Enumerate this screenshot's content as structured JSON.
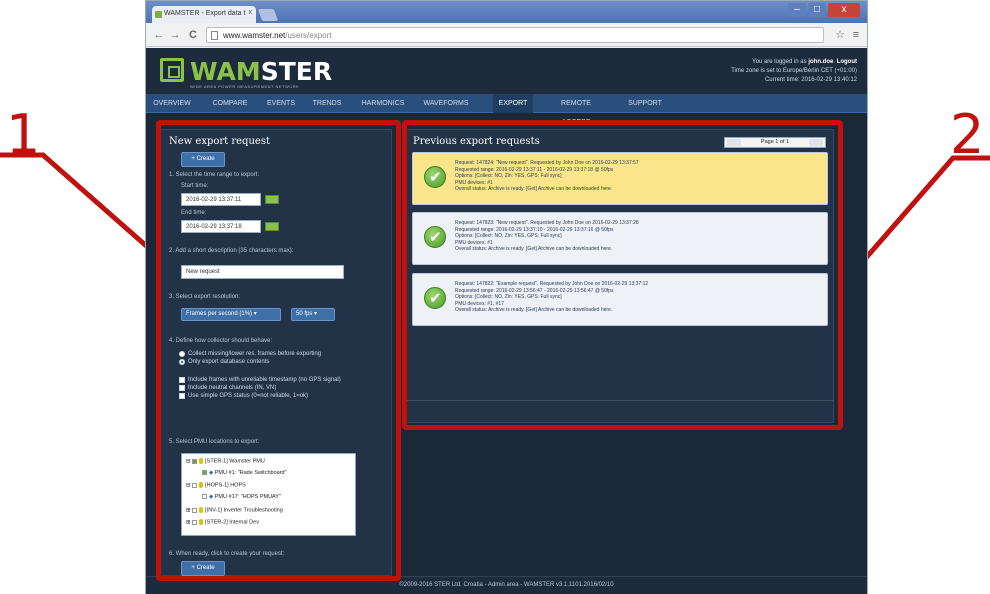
{
  "annotations": {
    "callout_left": "1",
    "callout_right": "2"
  },
  "browser": {
    "tab_title": "WAMSTER - Export data t",
    "url_host": "www.wamster.net",
    "url_path": "/users/export",
    "back_glyph": "←",
    "forward_glyph": "→",
    "reload_glyph": "C",
    "star_glyph": "☆",
    "menu_glyph": "≡",
    "close_tab_glyph": "x",
    "minimize_glyph": "–",
    "maximize_glyph": "□",
    "close_glyph": "x"
  },
  "header": {
    "logo_prefix": "WAM",
    "logo_suffix": "STER",
    "tagline": "WIDE AREA POWER MEASUREMENT NETWORK",
    "user_line_prefix": "You are logged in as",
    "user_name": "john.doe",
    "logout_label": "Logout",
    "tz_line": "Time zone is set to Europe/Berlin CET (+01:00)",
    "time_line": "Current time: 2016-02-29 13:40:12"
  },
  "menu": {
    "items": [
      "OVERVIEW",
      "COMPARE",
      "EVENTS",
      "TRENDS",
      "HARMONICS",
      "WAVEFORMS",
      "EXPORT",
      "REMOTE ACCESS",
      "SUPPORT"
    ]
  },
  "new_request": {
    "title": "New export request",
    "create_label": "+ Create",
    "step1": "1. Select the time range to export:",
    "start_label": "Start time:",
    "start_value": "2016-02-29 13:37:11",
    "end_label": "End time:",
    "end_value": "2016-02-29 13:37:18",
    "step2": "2. Add a short description (35 characters max):",
    "desc_value": "New request",
    "step3": "3. Select export resolution:",
    "resolution_value": "Frames per second (1%)",
    "fps_value": "50 fps",
    "step4": "4. Define how collector should behave:",
    "radio1": "Collect missing/lower res. frames before exporting",
    "radio2": "Only export database contents",
    "check1": "Include frames with unreliable timestamp (no GPS signal)",
    "check2": "Include neutral channels (IN, VN)",
    "check3": "Use simple GPS status (0=not reliable, 1=ok)",
    "step5": "5. Select PMU locations to export:",
    "tree": [
      "[STER-1] Wamster PMU",
      "PMU #1: \"Rade Switchboard\"",
      "[HOPS-1] HOPS",
      "PMU #17: \"HOPS PMUAY\"",
      "[INV-1] Inverter Troubleshooting",
      "[STER-2] Internal Dev"
    ],
    "step6": "6. When ready, click to create your request:",
    "create_label2": "+ Create"
  },
  "previous": {
    "title": "Previous export requests",
    "pager_label": "Page 1 of 1",
    "requests": [
      {
        "line1": "Request: 147824: \"New request\". Requested by John Doe on 2016-02-29 13:37:57",
        "line2": "Requested range: 2016-02-29 13:37:11 - 2016-02-29 13:37:18 @ 50fps",
        "line3": "Options: [Collect: NO, Zin: YES, GPS: Full sync]",
        "line4": "PMU devices: #1",
        "line5": "Overall status: Archive is ready. [Get] Archive can be downloaded here."
      },
      {
        "line1": "Request: 147823: \"New request\". Requested by John Doe on 2016-02-29 13:37:28",
        "line2": "Requested range: 2016-02-29 13:37:10 - 2016-02-29 13:37:16 @ 50fps",
        "line3": "Options: [Collect: NO, Zin: YES, GPS: Full sync]",
        "line4": "PMU devices: #1",
        "line5": "Overall status: Archive is ready. [Get] Archive can be downloaded here."
      },
      {
        "line1": "Request: 147822: \"Example request\". Requested by John Doe on 2016-02-29 13:37:12",
        "line2": "Requested range: 2016-02-29 13:56:47 - 2016-02-29 13:56:47 @ 50fps",
        "line3": "Options: [Collect: NO, Zin: YES, GPS: Full sync]",
        "line4": "PMU devices: #1, #17",
        "line5": "Overall status: Archive is ready. [Get] Archive can be downloaded here."
      }
    ]
  },
  "footer": {
    "text": "©2009-2016 STER Ltd. Croatia - Admin area - WAMSTER v3.1.1101.2016/02/10"
  },
  "colors": {
    "annotation_red": "#c0110f",
    "highlight_yellow": "#fbe58b",
    "accent_green": "#8bc34a",
    "nav_blue": "#2a4f7d"
  }
}
